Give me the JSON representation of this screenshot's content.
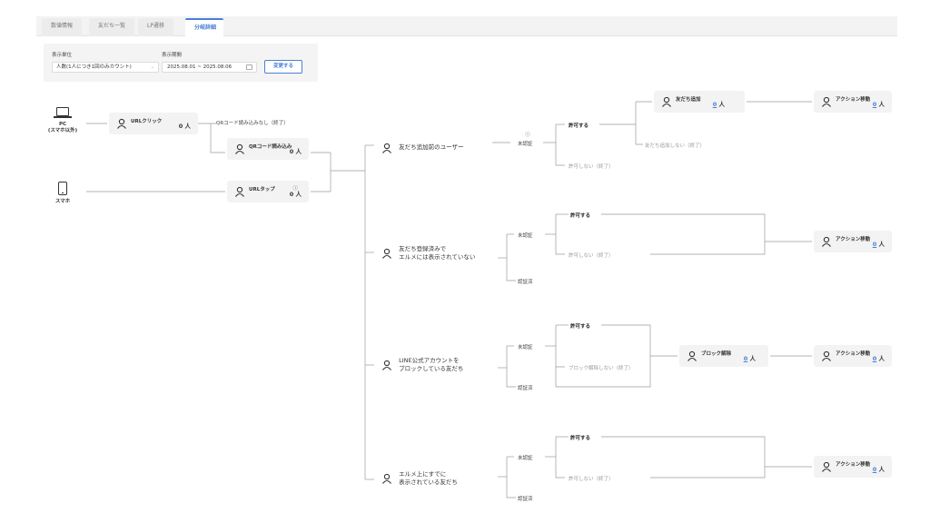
{
  "tabs": [
    {
      "label": "数値情報",
      "active": false
    },
    {
      "label": "友だち一覧",
      "active": false
    },
    {
      "label": "LP遷移",
      "active": false
    },
    {
      "label": "分岐詳細",
      "active": true
    }
  ],
  "filter": {
    "unit_label": "表示単位",
    "unit_value": "人数(1人につき1回のみカウント)",
    "period_label": "表示期間",
    "period_value": "2025.08.01 ~ 2025.08.06",
    "update_button": "変更する"
  },
  "devices": {
    "pc_line1": "PC",
    "pc_line2": "(スマホ以外)",
    "sp": "スマホ"
  },
  "url_click": {
    "title": "URLクリック",
    "count": "0 人"
  },
  "qr_none_label": "QRコード読み込みなし（終了）",
  "qr_read": {
    "title": "QRコード読み込み",
    "count": "0 人"
  },
  "url_tap": {
    "title": "URLタップ",
    "info": "ⓘ",
    "count": "0 人"
  },
  "segments": {
    "s1": "友だち追加前のユーザー",
    "s2_line1": "友だち登録済みで",
    "s2_line2": "エルメには表示されていない",
    "s3_line1": "LINE公式アカウントを",
    "s3_line2": "ブロックしている友だち",
    "s4_line1": "エルメ上にすでに",
    "s4_line2": "表示されている友だち"
  },
  "labels": {
    "info_icon": "ⓘ",
    "unverified": "未認証",
    "verified": "認証済",
    "allow": "許可する",
    "not_allow_end": "許可しない（終了）",
    "friend_not_added_end": "友だち追加しない（終了）",
    "block_not_released_end": "ブロック解除しない（終了）"
  },
  "friend_added": {
    "title": "友だち追加",
    "num": "0",
    "unit": "人"
  },
  "block_release": {
    "title": "ブロック解除",
    "num": "0",
    "unit": "人"
  },
  "action": {
    "title": "アクション移動",
    "num": "0",
    "unit": "人"
  },
  "colors": {
    "accent": "#4a7fd6",
    "line": "#999999",
    "card_bg": "#f3f3f3"
  }
}
